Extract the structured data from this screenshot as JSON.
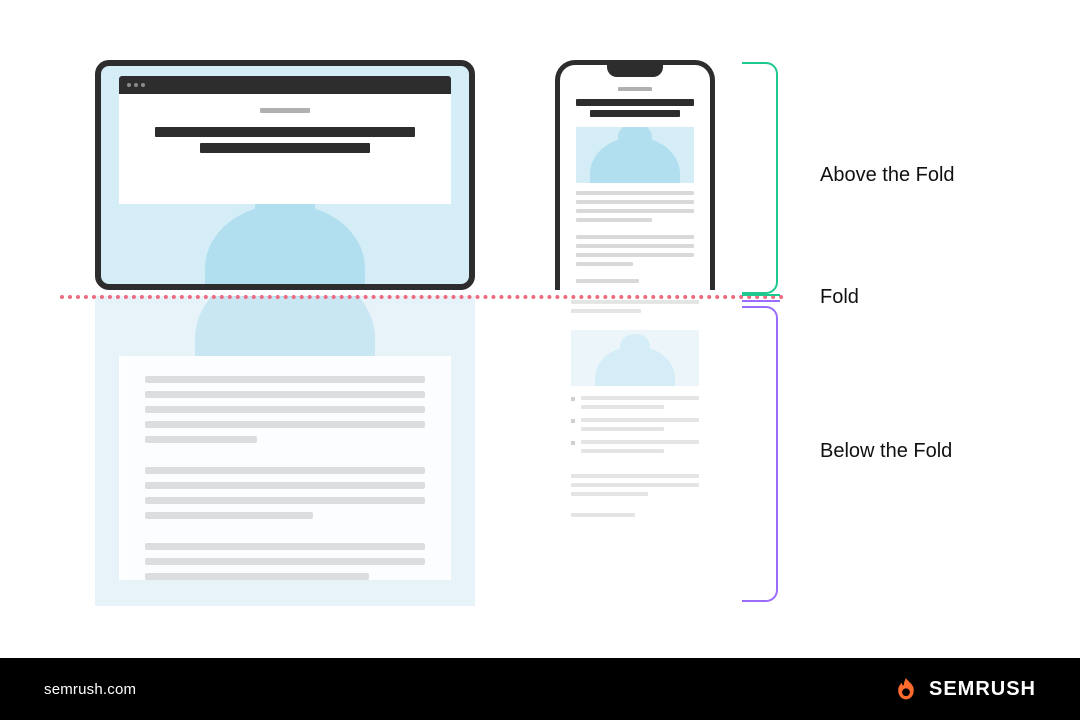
{
  "labels": {
    "above": "Above the Fold",
    "fold": "Fold",
    "below": "Below the Fold"
  },
  "footer": {
    "site": "semrush.com",
    "brand": "SEMRUSH"
  },
  "colors": {
    "fold_line": "#f06a80",
    "bracket_above": "#1ec98f",
    "bracket_below": "#9b6dff",
    "content_bg": "#d5edf6",
    "blob": "#b2dff0",
    "brand_accent": "#ff6b2c"
  }
}
